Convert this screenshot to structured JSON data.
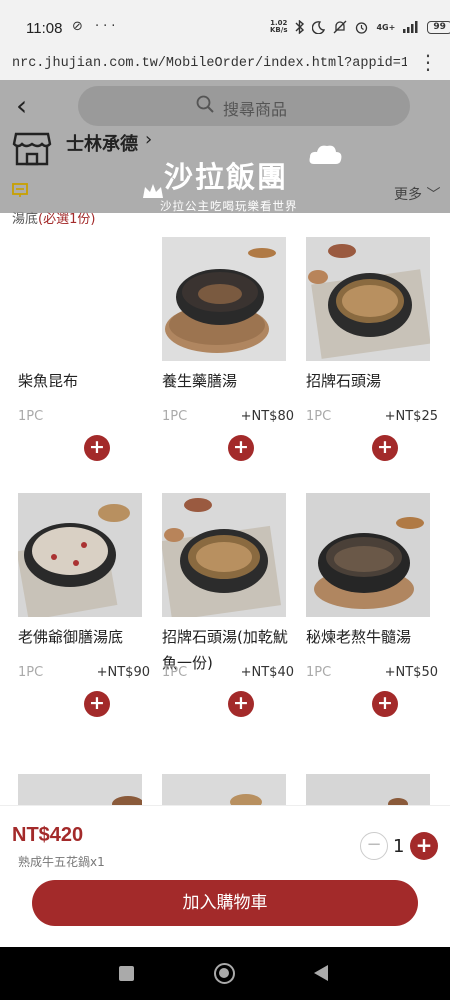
{
  "status_bar": {
    "time": "11:08",
    "left_icons": "⊘ ···",
    "net_speed_value": "1.02",
    "net_speed_unit": "KB/s",
    "signal_label": "4G+",
    "battery": "99"
  },
  "browser": {
    "url": "nrc.jhujian.com.tw/MobileOrder/index.html?appid=123&com···",
    "menu_glyph": "⋮"
  },
  "header": {
    "back_glyph": "‹",
    "search_placeholder": "搜尋商品",
    "store_name": "士林承德",
    "store_chevron": "›",
    "more_label": "更多 ﹀"
  },
  "watermark": {
    "title": "沙拉飯團",
    "subtitle": "沙拉公主吃喝玩樂看世界"
  },
  "section": {
    "title": "湯底",
    "required": "(必選1份)"
  },
  "products": [
    {
      "name": "柴魚昆布",
      "unit": "1PC",
      "price": "",
      "photo": "none"
    },
    {
      "name": "養生藥膳湯",
      "unit": "1PC",
      "price": "+NT$80",
      "photo": "herbal"
    },
    {
      "name": "招牌石頭湯",
      "unit": "1PC",
      "price": "+NT$25",
      "photo": "stone"
    },
    {
      "name": "老佛爺御膳湯底",
      "unit": "1PC",
      "price": "+NT$90",
      "photo": "milky"
    },
    {
      "name": "招牌石頭湯(加乾魷魚一份)",
      "unit": "1PC",
      "price": "+NT$40",
      "photo": "stone"
    },
    {
      "name": "秘煉老熬牛髓湯",
      "unit": "1PC",
      "price": "+NT$50",
      "photo": "beef"
    }
  ],
  "cart": {
    "total": "NT$420",
    "summary": "熟成牛五花鍋x1",
    "minus_glyph": "−",
    "quantity": "1",
    "plus_glyph": "+",
    "add_to_cart": "加入購物車"
  },
  "colors": {
    "accent": "#a32a2a",
    "overlay": "#969696"
  }
}
